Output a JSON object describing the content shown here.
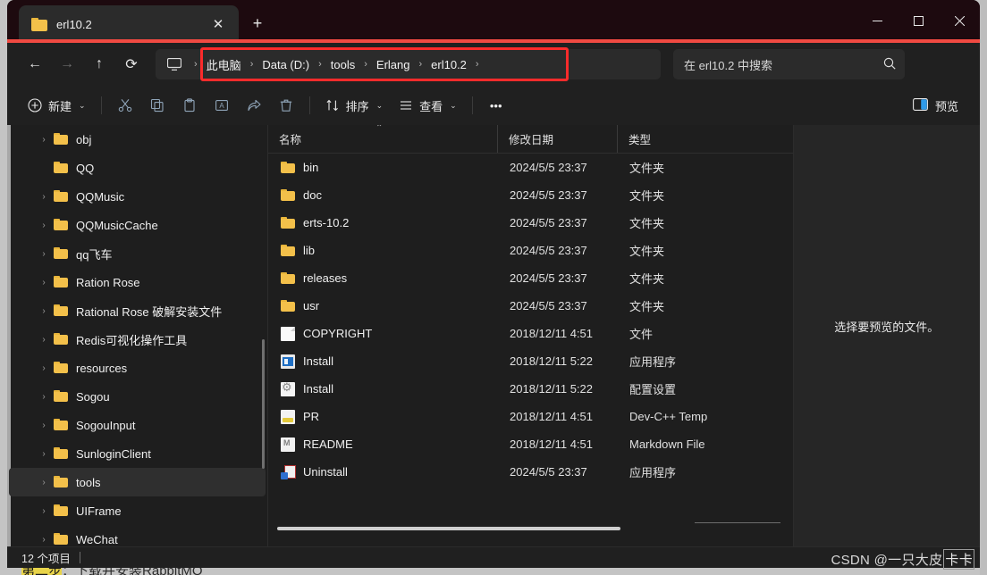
{
  "background": {
    "tutorial_text_prefix": "第二步",
    "tutorial_text_rest": "：下载并安装RabbitMQ"
  },
  "titlebar": {
    "tab_label": "erl10.2",
    "tab_folder_icon": "folder-icon",
    "close_tab_icon": "✕",
    "new_tab_icon": "+",
    "minimize_icon": "—",
    "maximize_icon": "☐",
    "close_icon": "✕"
  },
  "navbar": {
    "back_icon": "←",
    "forward_icon": "→",
    "up_icon": "↑",
    "refresh_icon": "⟳",
    "this_pc_icon": "monitor-icon",
    "separator": "›",
    "breadcrumbs": [
      {
        "label": "此电脑"
      },
      {
        "label": "Data (D:)"
      },
      {
        "label": "tools"
      },
      {
        "label": "Erlang"
      },
      {
        "label": "erl10.2"
      }
    ],
    "highlight_color": "#fb2b2b",
    "search": {
      "placeholder": "在 erl10.2 中搜索",
      "icon": "search-icon"
    }
  },
  "commandbar": {
    "new_label": "新建",
    "new_icon": "⊕",
    "chevron": "⌄",
    "cut_icon": "✂",
    "copy_icon": "copy-icon",
    "paste_icon": "paste-icon",
    "rename_icon": "rename-icon",
    "share_icon": "share-icon",
    "delete_icon": "trash-icon",
    "sort_label": "排序",
    "sort_icon": "↑↓",
    "view_label": "查看",
    "view_icon": "☰",
    "more_icon": "•••",
    "preview_label": "预览",
    "preview_icon": "split-pane-icon"
  },
  "sidebar": {
    "items": [
      {
        "label": "obj",
        "expandable": true,
        "selected": false
      },
      {
        "label": "QQ",
        "expandable": false,
        "selected": false
      },
      {
        "label": "QQMusic",
        "expandable": true,
        "selected": false
      },
      {
        "label": "QQMusicCache",
        "expandable": true,
        "selected": false
      },
      {
        "label": "qq飞车",
        "expandable": true,
        "selected": false
      },
      {
        "label": "Ration Rose",
        "expandable": true,
        "selected": false
      },
      {
        "label": "Rational Rose 破解安装文件",
        "expandable": true,
        "selected": false
      },
      {
        "label": "Redis可视化操作工具",
        "expandable": true,
        "selected": false
      },
      {
        "label": "resources",
        "expandable": true,
        "selected": false
      },
      {
        "label": "Sogou",
        "expandable": true,
        "selected": false
      },
      {
        "label": "SogouInput",
        "expandable": true,
        "selected": false
      },
      {
        "label": "SunloginClient",
        "expandable": true,
        "selected": false
      },
      {
        "label": "tools",
        "expandable": true,
        "selected": true
      },
      {
        "label": "UIFrame",
        "expandable": true,
        "selected": false
      },
      {
        "label": "WeChat",
        "expandable": true,
        "selected": false
      }
    ],
    "chevron": "›"
  },
  "filelist": {
    "columns": {
      "name": "名称",
      "date": "修改日期",
      "type": "类型"
    },
    "sort_caret": "⌃",
    "rows": [
      {
        "name": "bin",
        "date": "2024/5/5 23:37",
        "type": "文件夹",
        "icon": "folder"
      },
      {
        "name": "doc",
        "date": "2024/5/5 23:37",
        "type": "文件夹",
        "icon": "folder"
      },
      {
        "name": "erts-10.2",
        "date": "2024/5/5 23:37",
        "type": "文件夹",
        "icon": "folder"
      },
      {
        "name": "lib",
        "date": "2024/5/5 23:37",
        "type": "文件夹",
        "icon": "folder"
      },
      {
        "name": "releases",
        "date": "2024/5/5 23:37",
        "type": "文件夹",
        "icon": "folder"
      },
      {
        "name": "usr",
        "date": "2024/5/5 23:37",
        "type": "文件夹",
        "icon": "folder"
      },
      {
        "name": "COPYRIGHT",
        "date": "2018/12/11 4:51",
        "type": "文件",
        "icon": "doc"
      },
      {
        "name": "Install",
        "date": "2018/12/11 5:22",
        "type": "应用程序",
        "icon": "exe"
      },
      {
        "name": "Install",
        "date": "2018/12/11 5:22",
        "type": "配置设置",
        "icon": "cfg"
      },
      {
        "name": "PR",
        "date": "2018/12/11 4:51",
        "type": "Dev-C++ Temp",
        "icon": "devcpp"
      },
      {
        "name": "README",
        "date": "2018/12/11 4:51",
        "type": "Markdown File",
        "icon": "md"
      },
      {
        "name": "Uninstall",
        "date": "2024/5/5 23:37",
        "type": "应用程序",
        "icon": "uninst"
      }
    ]
  },
  "preview": {
    "empty_text": "选择要预览的文件。"
  },
  "statusbar": {
    "item_count": "12 个项目"
  },
  "watermark": {
    "prefix": "CSDN @一只大皮",
    "boxed": "卡卡"
  }
}
